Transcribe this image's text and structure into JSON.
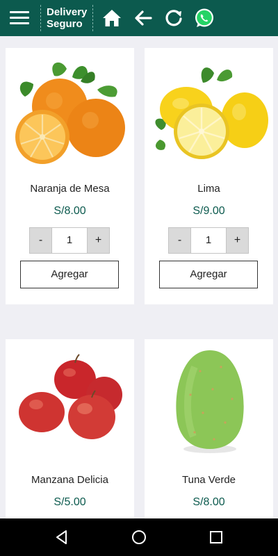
{
  "header": {
    "brand_line1": "Delivery",
    "brand_line2": "Seguro",
    "icons": [
      "menu-icon",
      "home-icon",
      "back-arrow-icon",
      "refresh-icon",
      "whatsapp-icon"
    ]
  },
  "products": [
    {
      "name": "Naranja de Mesa",
      "price": "S/8.00",
      "qty_minus": "-",
      "qty": "1",
      "qty_plus": "+",
      "add_label": "Agregar",
      "image": "orange-image"
    },
    {
      "name": "Lima",
      "price": "S/9.00",
      "qty_minus": "-",
      "qty": "1",
      "qty_plus": "+",
      "add_label": "Agregar",
      "image": "lemon-image"
    },
    {
      "name": "Manzana Delicia",
      "price": "S/5.00",
      "image": "apple-image"
    },
    {
      "name": "Tuna Verde",
      "price": "S/8.00",
      "image": "prickly-pear-image"
    }
  ],
  "navbar": {
    "icons": [
      "back-triangle-icon",
      "home-circle-icon",
      "recents-square-icon"
    ]
  },
  "colors": {
    "primary": "#0c5a4e",
    "background": "#efeff4",
    "whatsapp": "#25d366"
  }
}
